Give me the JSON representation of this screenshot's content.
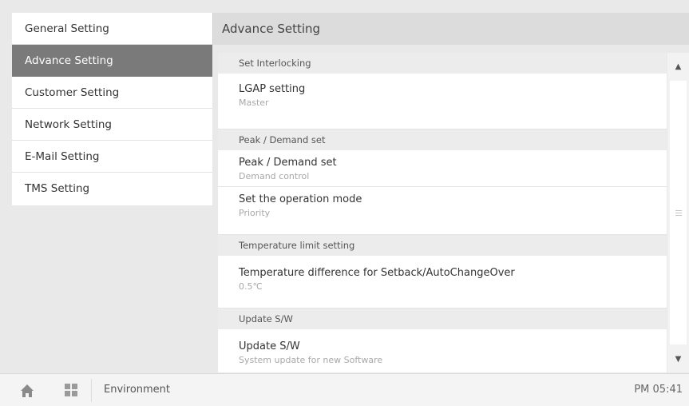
{
  "sidebar": {
    "items": [
      {
        "label": "General Setting"
      },
      {
        "label": "Advance Setting"
      },
      {
        "label": "Customer Setting"
      },
      {
        "label": "Network Setting"
      },
      {
        "label": "E-Mail Setting"
      },
      {
        "label": "TMS Setting"
      }
    ],
    "active_index": 1
  },
  "main": {
    "title": "Advance Setting",
    "sections": [
      {
        "header": "Set Interlocking",
        "rows": [
          {
            "title": "LGAP setting",
            "value": "Master"
          }
        ]
      },
      {
        "header": "Peak / Demand set",
        "rows": [
          {
            "title": "Peak / Demand set",
            "value": "Demand control"
          },
          {
            "title": "Set the operation mode",
            "value": "Priority"
          }
        ]
      },
      {
        "header": "Temperature limit setting",
        "rows": [
          {
            "title": "Temperature difference for Setback/AutoChangeOver",
            "value": "0.5℃"
          }
        ]
      },
      {
        "header": "Update S/W",
        "rows": [
          {
            "title": "Update S/W",
            "value": "System update for new Software"
          }
        ]
      }
    ]
  },
  "scrollbar": {
    "up_icon": "triangle-up-icon",
    "down_icon": "triangle-down-icon",
    "up_glyph": "▲",
    "down_glyph": "▼"
  },
  "footer": {
    "home_icon": "home-icon",
    "grid_icon": "grid-icon",
    "breadcrumb": "Environment",
    "clock": "PM 05:41"
  }
}
